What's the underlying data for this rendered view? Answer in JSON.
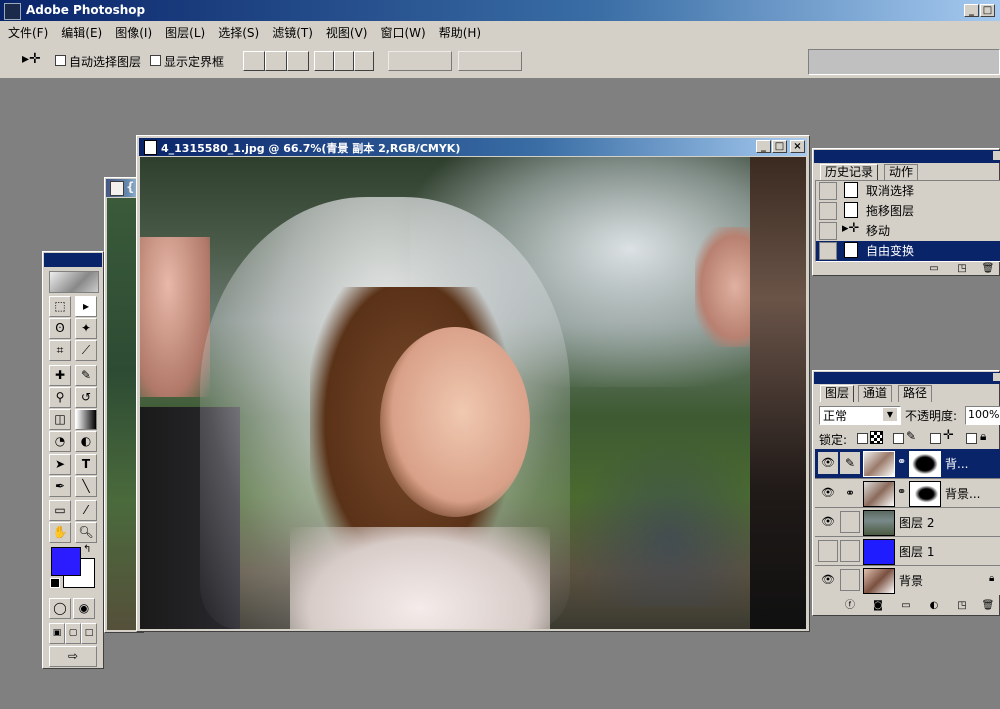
{
  "app": {
    "title": "Adobe Photoshop"
  },
  "menu": [
    "文件(F)",
    "编辑(E)",
    "图像(I)",
    "图层(L)",
    "选择(S)",
    "滤镜(T)",
    "视图(V)",
    "窗口(W)",
    "帮助(H)"
  ],
  "options": {
    "auto_select_label": "自动选择图层",
    "show_bounds_label": "显示定界框"
  },
  "document": {
    "title": "4_1315580_1.jpg @ 66.7%(青景 副本 2,RGB/CMYK)",
    "back_title": "{"
  },
  "history": {
    "tabs": [
      "历史记录",
      "动作"
    ],
    "items": [
      "取消选择",
      "拖移图层",
      "移动",
      "自由变换"
    ]
  },
  "layers": {
    "tabs": [
      "图层",
      "通道",
      "路径"
    ],
    "blend_mode": "正常",
    "opacity_label": "不透明度:",
    "opacity": "100%",
    "lock_label": "锁定:",
    "items": [
      {
        "name": "背..."
      },
      {
        "name": "背景..."
      },
      {
        "name": "图层 2"
      },
      {
        "name": "图层 1"
      },
      {
        "name": "背景"
      }
    ]
  },
  "colors": {
    "foreground": "#2a1cff",
    "background": "#ffffff",
    "layer1_fill": "#1f1cff",
    "selection": "#0a246a"
  }
}
